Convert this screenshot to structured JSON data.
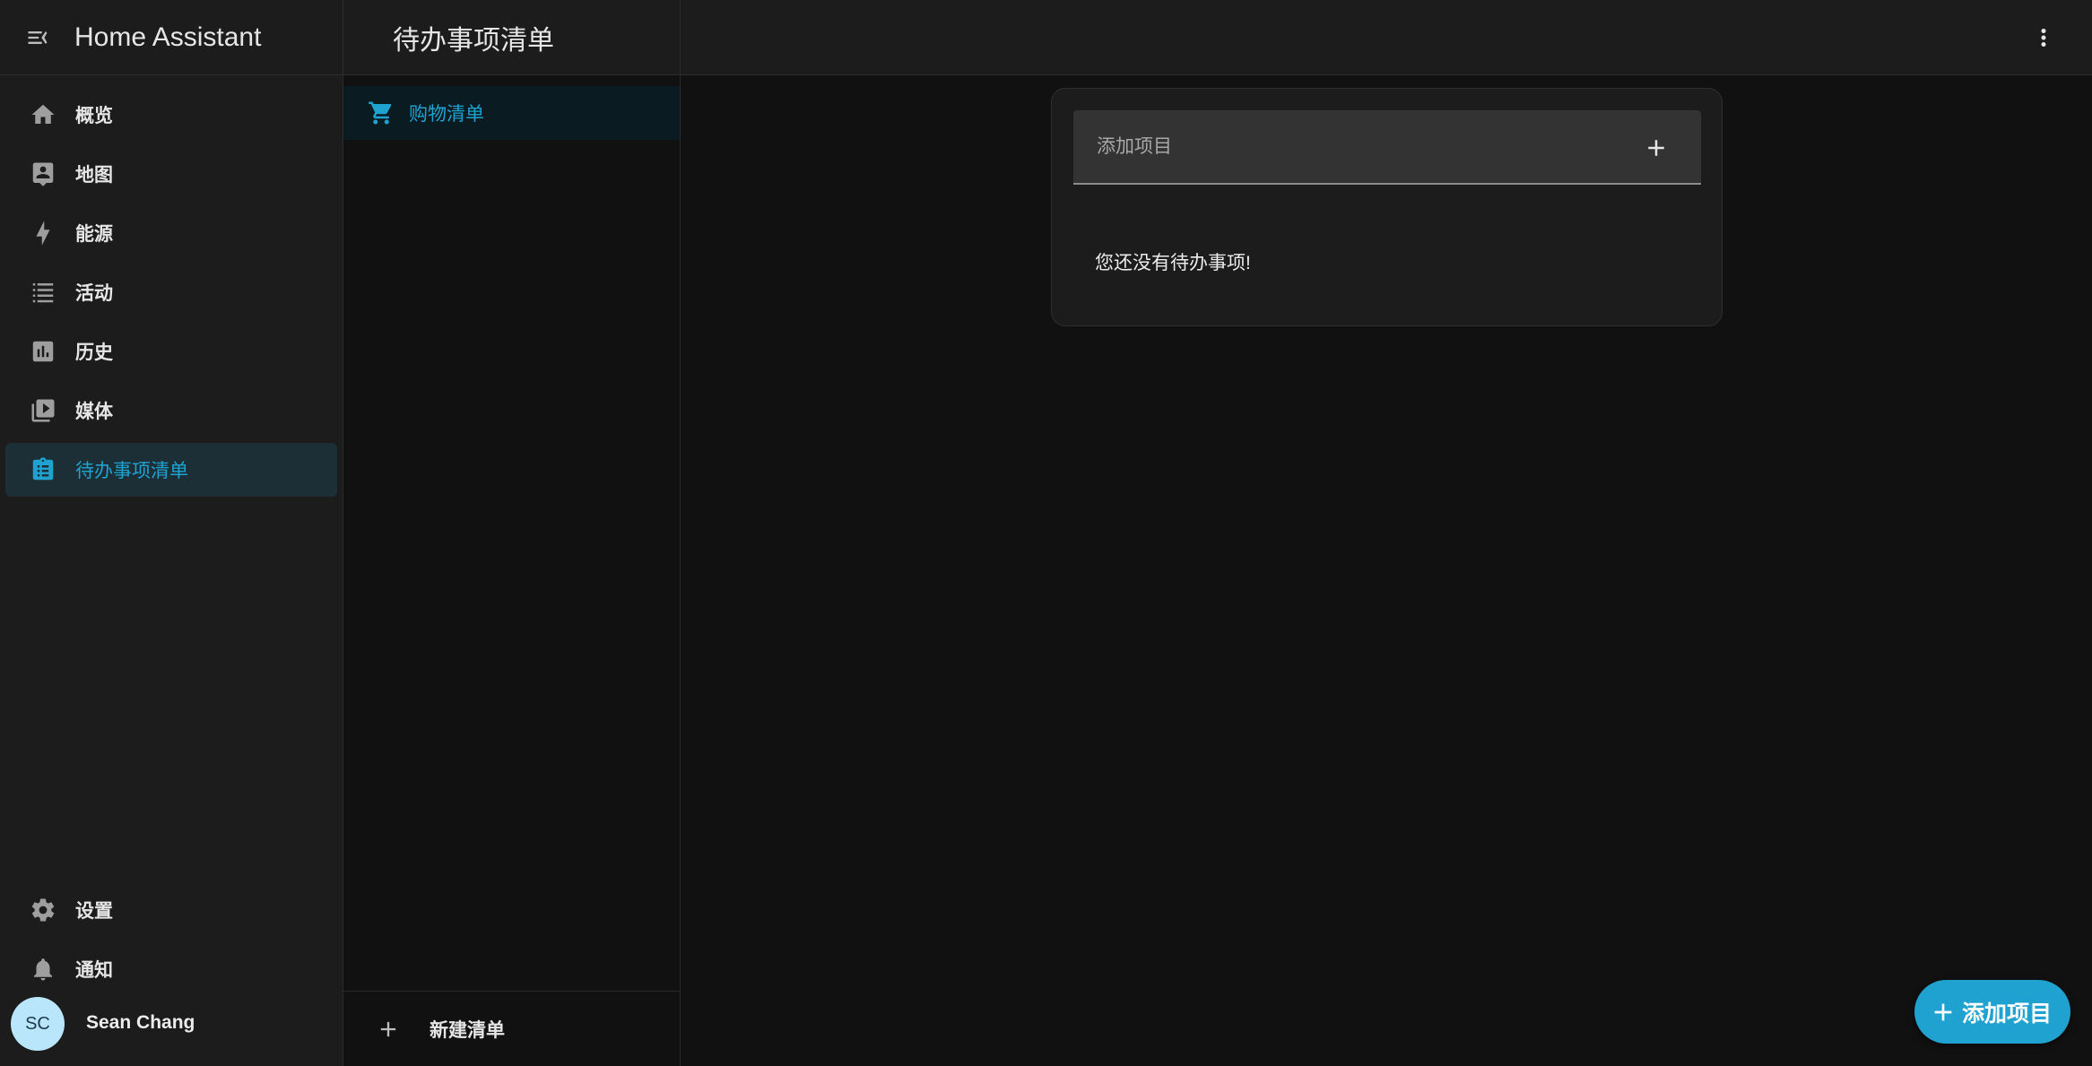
{
  "app": {
    "title": "Home Assistant"
  },
  "sidebar": {
    "items": [
      {
        "label": "概览",
        "icon": "home-icon"
      },
      {
        "label": "地图",
        "icon": "map-icon"
      },
      {
        "label": "能源",
        "icon": "lightning-icon"
      },
      {
        "label": "活动",
        "icon": "list-icon"
      },
      {
        "label": "历史",
        "icon": "chart-icon"
      },
      {
        "label": "媒体",
        "icon": "media-icon"
      },
      {
        "label": "待办事项清单",
        "icon": "clipboard-list-icon",
        "active": true
      }
    ],
    "bottom": [
      {
        "label": "设置",
        "icon": "gear-icon"
      },
      {
        "label": "通知",
        "icon": "bell-icon"
      }
    ],
    "user": {
      "initials": "SC",
      "name": "Sean Chang"
    }
  },
  "lists_panel": {
    "title": "待办事项清单",
    "lists": [
      {
        "label": "购物清单",
        "icon": "cart-icon",
        "selected": true
      }
    ],
    "new_list_label": "新建清单"
  },
  "main": {
    "add_item_placeholder": "添加项目",
    "empty_message": "您还没有待办事项!",
    "fab_label": "添加项目"
  },
  "colors": {
    "accent": "#1fa2d0",
    "background": "#111111",
    "sidebar": "#1c1c1c"
  }
}
